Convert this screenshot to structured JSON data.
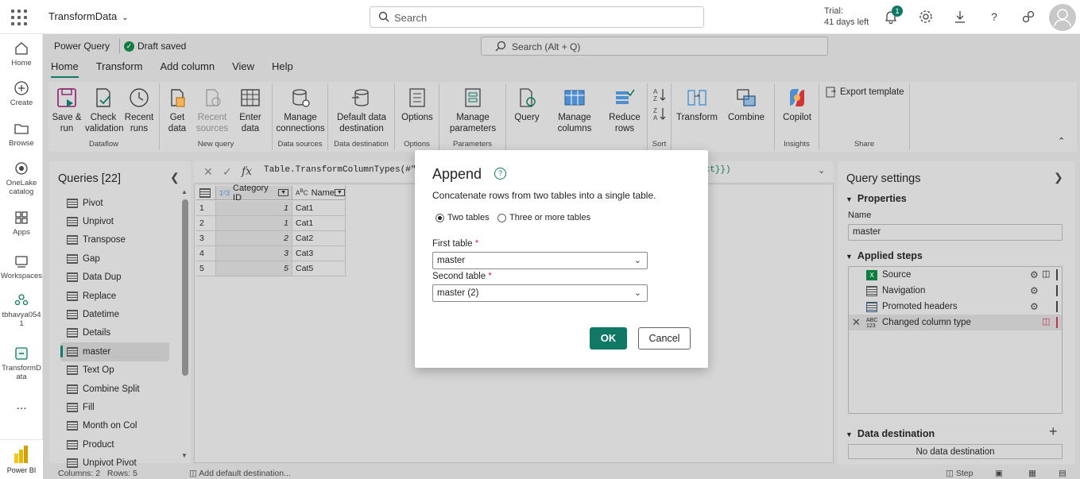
{
  "topbar": {
    "app_name": "TransformData",
    "search_placeholder": "Search",
    "trial_line1": "Trial:",
    "trial_line2": "41 days left",
    "notification_count": "1"
  },
  "leftnav": {
    "items": [
      {
        "label": "Home",
        "icon": "home-icon"
      },
      {
        "label": "Create",
        "icon": "plus-circle-icon"
      },
      {
        "label": "Browse",
        "icon": "folder-icon"
      },
      {
        "label": "OneLake catalog",
        "icon": "onelake-icon"
      },
      {
        "label": "Apps",
        "icon": "apps-icon"
      },
      {
        "label": "Workspaces",
        "icon": "workspaces-icon"
      },
      {
        "label": "tbhavya0541",
        "icon": "workspace-people-icon"
      },
      {
        "label": "TransformData",
        "icon": "dataflow-icon"
      },
      {
        "label": "...",
        "icon": "more-icon"
      }
    ],
    "footer_label": "Power BI"
  },
  "pq": {
    "title": "Power Query",
    "draft_status": "Draft saved",
    "search_placeholder": "Search (Alt + Q)",
    "tabs": [
      "Home",
      "Transform",
      "Add column",
      "View",
      "Help"
    ],
    "active_tab": "Home"
  },
  "ribbon": {
    "groups": [
      {
        "name": "Dataflow",
        "buttons": [
          "Save & run",
          "Check validation",
          "Recent runs"
        ]
      },
      {
        "name": "New query",
        "buttons": [
          "Get data",
          "Recent sources",
          "Enter data"
        ]
      },
      {
        "name": "Data sources",
        "buttons": [
          "Manage connections"
        ]
      },
      {
        "name": "Data destination",
        "buttons": [
          "Default data destination"
        ]
      },
      {
        "name": "Options",
        "buttons": [
          "Options"
        ]
      },
      {
        "name": "Parameters",
        "buttons": [
          "Manage parameters"
        ]
      },
      {
        "name": "",
        "buttons": [
          "Query",
          "Manage columns",
          "Reduce rows"
        ]
      },
      {
        "name": "Sort",
        "buttons": []
      },
      {
        "name": "",
        "buttons": [
          "Transform",
          "Combine"
        ]
      },
      {
        "name": "Insights",
        "buttons": [
          "Copilot"
        ]
      },
      {
        "name": "Share",
        "buttons": [
          "Export template"
        ]
      }
    ]
  },
  "queries": {
    "title": "Queries [22]",
    "items": [
      "Pivot",
      "Unpivot",
      "Transpose",
      "Gap",
      "Data Dup",
      "Replace",
      "Datetime",
      "Details",
      "master",
      "Text Op",
      "Combine Split",
      "Fill",
      "Month on Col",
      "Product",
      "Unpivot Pivot"
    ],
    "selected": "master"
  },
  "formula": {
    "text_left": "Table.TransformColumnTypes(#\"Pr",
    "text_right": "ext}})"
  },
  "grid": {
    "columns": [
      {
        "type": "1²3",
        "name": "Category ID"
      },
      {
        "type": "A^B_C",
        "name": "Name"
      }
    ],
    "rows": [
      {
        "n": "1",
        "id": "1",
        "name": "Cat1"
      },
      {
        "n": "2",
        "id": "1",
        "name": "Cat1"
      },
      {
        "n": "3",
        "id": "2",
        "name": "Cat2"
      },
      {
        "n": "4",
        "id": "3",
        "name": "Cat3"
      },
      {
        "n": "5",
        "id": "5",
        "name": "Cat5"
      }
    ]
  },
  "settings": {
    "title": "Query settings",
    "properties_label": "Properties",
    "name_label": "Name",
    "name_value": "master",
    "applied_steps_label": "Applied steps",
    "steps": [
      "Source",
      "Navigation",
      "Promoted headers",
      "Changed column type"
    ],
    "data_destination_label": "Data destination",
    "no_destination": "No data destination"
  },
  "status": {
    "columns_rows": "Columns: 2   Rows: 5",
    "add_destination": "Add default destination...",
    "step_label": "Step"
  },
  "dialog": {
    "title": "Append",
    "description": "Concatenate rows from two tables into a single table.",
    "option_two": "Two tables",
    "option_three": "Three or more tables",
    "first_label": "First table",
    "first_value": "master",
    "second_label": "Second table",
    "second_value": "master (2)",
    "required_mark": "*",
    "ok_label": "OK",
    "cancel_label": "Cancel"
  }
}
